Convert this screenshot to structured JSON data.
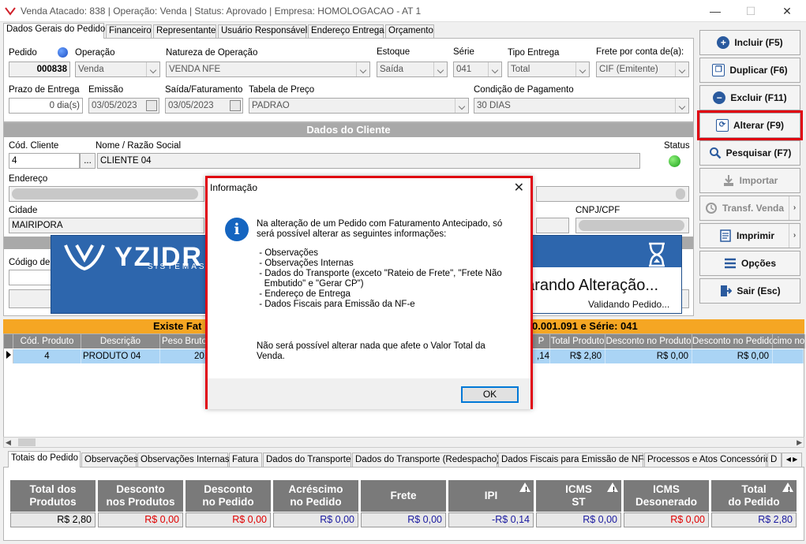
{
  "window": {
    "title": "Venda Atacado: 838 | Operação: Venda | Status: Aprovado | Empresa: HOMOLOGACAO - AT 1",
    "minimize": "—",
    "maximize": "☐",
    "close": "✕"
  },
  "top_tabs": [
    "Dados Gerais do Pedido",
    "Financeiro",
    "Representante",
    "Usuário Responsável",
    "Endereço Entrega",
    "Orçamento"
  ],
  "order": {
    "pedido_label": "Pedido",
    "pedido_value": "000838",
    "operacao_label": "Operação",
    "operacao_value": "Venda",
    "natureza_label": "Natureza de Operação",
    "natureza_value": "VENDA NFE",
    "estoque_label": "Estoque",
    "estoque_value": "Saída",
    "serie_label": "Série",
    "serie_value": "041",
    "tipo_entrega_label": "Tipo Entrega",
    "tipo_entrega_value": "Total",
    "frete_label": "Frete por conta de(a):",
    "frete_value": "CIF (Emitente)",
    "prazo_label": "Prazo de Entrega",
    "prazo_value": "0 dia(s)",
    "emissao_label": "Emissão",
    "emissao_value": "03/05/2023",
    "saida_label": "Saída/Faturamento",
    "saida_value": "03/05/2023",
    "tabela_label": "Tabela de Preço",
    "tabela_value": "PADRAO",
    "condicao_label": "Condição de Pagamento",
    "condicao_value": "30 DIAS"
  },
  "client": {
    "section_title": "Dados do Cliente",
    "cod_label": "Cód. Cliente",
    "cod_value": "4",
    "lookup_btn": "...",
    "nome_label": "Nome / Razão Social",
    "nome_value": "CLIENTE 04",
    "status_label": "Status",
    "endereco_label": "Endereço",
    "cidade_label": "Cidade",
    "cidade_value": "MAIRIPORA",
    "cnpj_label": "CNPJ/CPF",
    "codigo_label": "Código de E"
  },
  "banner": {
    "logo_text": "YZIDR",
    "logo_sub": "SISTEMAS",
    "status_text": "parando Alteração...",
    "sub_text": "Validando Pedido..."
  },
  "toolbar": [
    {
      "label": "Incluir (F5)",
      "icon": "plus-icon"
    },
    {
      "label": "Duplicar (F6)",
      "icon": "duplicate-icon"
    },
    {
      "label": "Excluir (F11)",
      "icon": "minus-icon"
    },
    {
      "label": "Alterar (F9)",
      "icon": "edit-icon"
    },
    {
      "label": "Pesquisar (F7)",
      "icon": "search-icon"
    },
    {
      "label": "Importar",
      "icon": "import-icon"
    },
    {
      "label": "Transf. Venda",
      "icon": "transfer-icon"
    },
    {
      "label": "Imprimir",
      "icon": "print-icon"
    },
    {
      "label": "Opções",
      "icon": "menu-icon"
    },
    {
      "label": "Sair (Esc)",
      "icon": "exit-icon"
    }
  ],
  "billing_bar": {
    "left": "Existe Fat",
    "right": "0.001.091 e Série: 041"
  },
  "grid": {
    "headers": [
      "Cód. Produto",
      "Descrição",
      "Peso Bruto",
      "P",
      "Total Produto",
      "Desconto no Produto",
      "Desconto no Pedido",
      "cimo no I"
    ],
    "row": [
      "4",
      "PRODUTO 04",
      "20,",
      ",14",
      "R$ 2,80",
      "R$ 0,00",
      "R$ 0,00",
      ""
    ]
  },
  "bottom_tabs": [
    "Totais do Pedido",
    "Observações",
    "Observações Internas",
    "Fatura",
    "Dados do Transporte",
    "Dados do Transporte (Redespacho)",
    "Dados Fiscais para Emissão de NFe",
    "Processos e Atos Concessório",
    "D"
  ],
  "totals": [
    {
      "l1": "Total dos",
      "l2": "Produtos",
      "value": "R$ 2,80",
      "color": "#000000"
    },
    {
      "l1": "Desconto",
      "l2": "nos Produtos",
      "value": "R$ 0,00",
      "color": "#e00000"
    },
    {
      "l1": "Desconto",
      "l2": "no Pedido",
      "value": "R$ 0,00",
      "color": "#e00000"
    },
    {
      "l1": "Acréscimo",
      "l2": "no Pedido",
      "value": "R$ 0,00",
      "color": "#1a1aa0"
    },
    {
      "l1": "Frete",
      "l2": "",
      "value": "R$ 0,00",
      "color": "#1a1aa0"
    },
    {
      "l1": "IPI",
      "l2": "",
      "value": "-R$ 0,14",
      "color": "#1a1aa0"
    },
    {
      "l1": "ICMS",
      "l2": "ST",
      "value": "R$ 0,00",
      "color": "#1a1aa0"
    },
    {
      "l1": "ICMS",
      "l2": "Desonerado",
      "value": "R$ 0,00",
      "color": "#e00000"
    },
    {
      "l1": "Total",
      "l2": "do Pedido",
      "value": "R$ 2,80",
      "color": "#1a1aa0"
    }
  ],
  "dialog": {
    "title": "Informação",
    "close": "✕",
    "p1": "Na alteração de um Pedido com Faturamento Antecipado, só\nserá possível alterar as seguintes informações:",
    "p2": " - Observações\n - Observações Internas\n - Dados do Transporte (exceto \"Rateio de Frete\", \"Frete Não\n   Embutido\" e \"Gerar CP\")\n - Endereço de Entrega\n - Dados Fiscais para Emissão da NF-e",
    "p3": "Não será possível alterar nada que afete o Valor Total da\nVenda.",
    "ok": "OK"
  }
}
